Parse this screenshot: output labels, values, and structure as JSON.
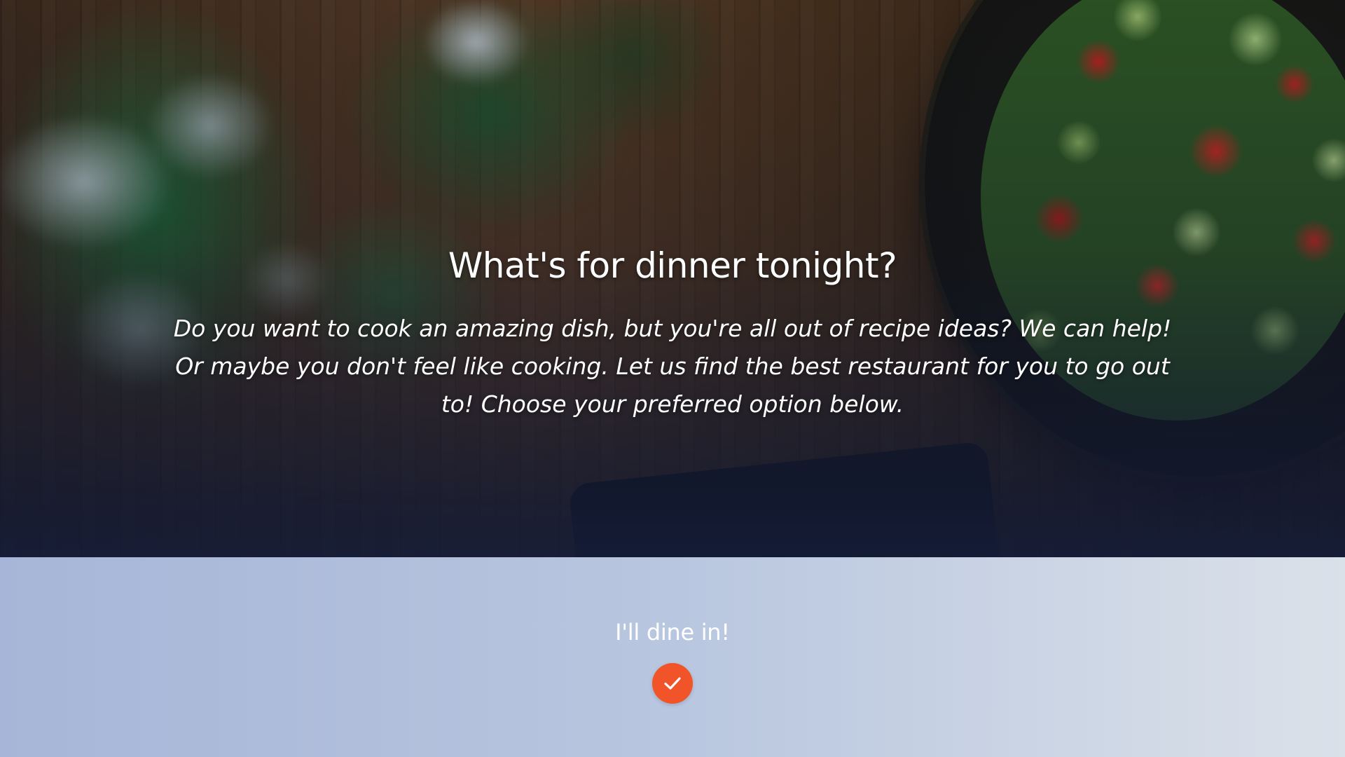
{
  "hero": {
    "title": "What's for dinner tonight?",
    "subtitle": "Do you want to cook an amazing dish, but you're all out of recipe ideas? We can help! Or maybe you don't feel like cooking. Let us find the best restaurant for you to go out to! Choose your preferred option below.",
    "background_image": "food-table-photo"
  },
  "options": {
    "dine_in_label": "I'll dine in!",
    "dine_in_icon": "checkmark-icon",
    "accent_color": "#f2542a"
  }
}
